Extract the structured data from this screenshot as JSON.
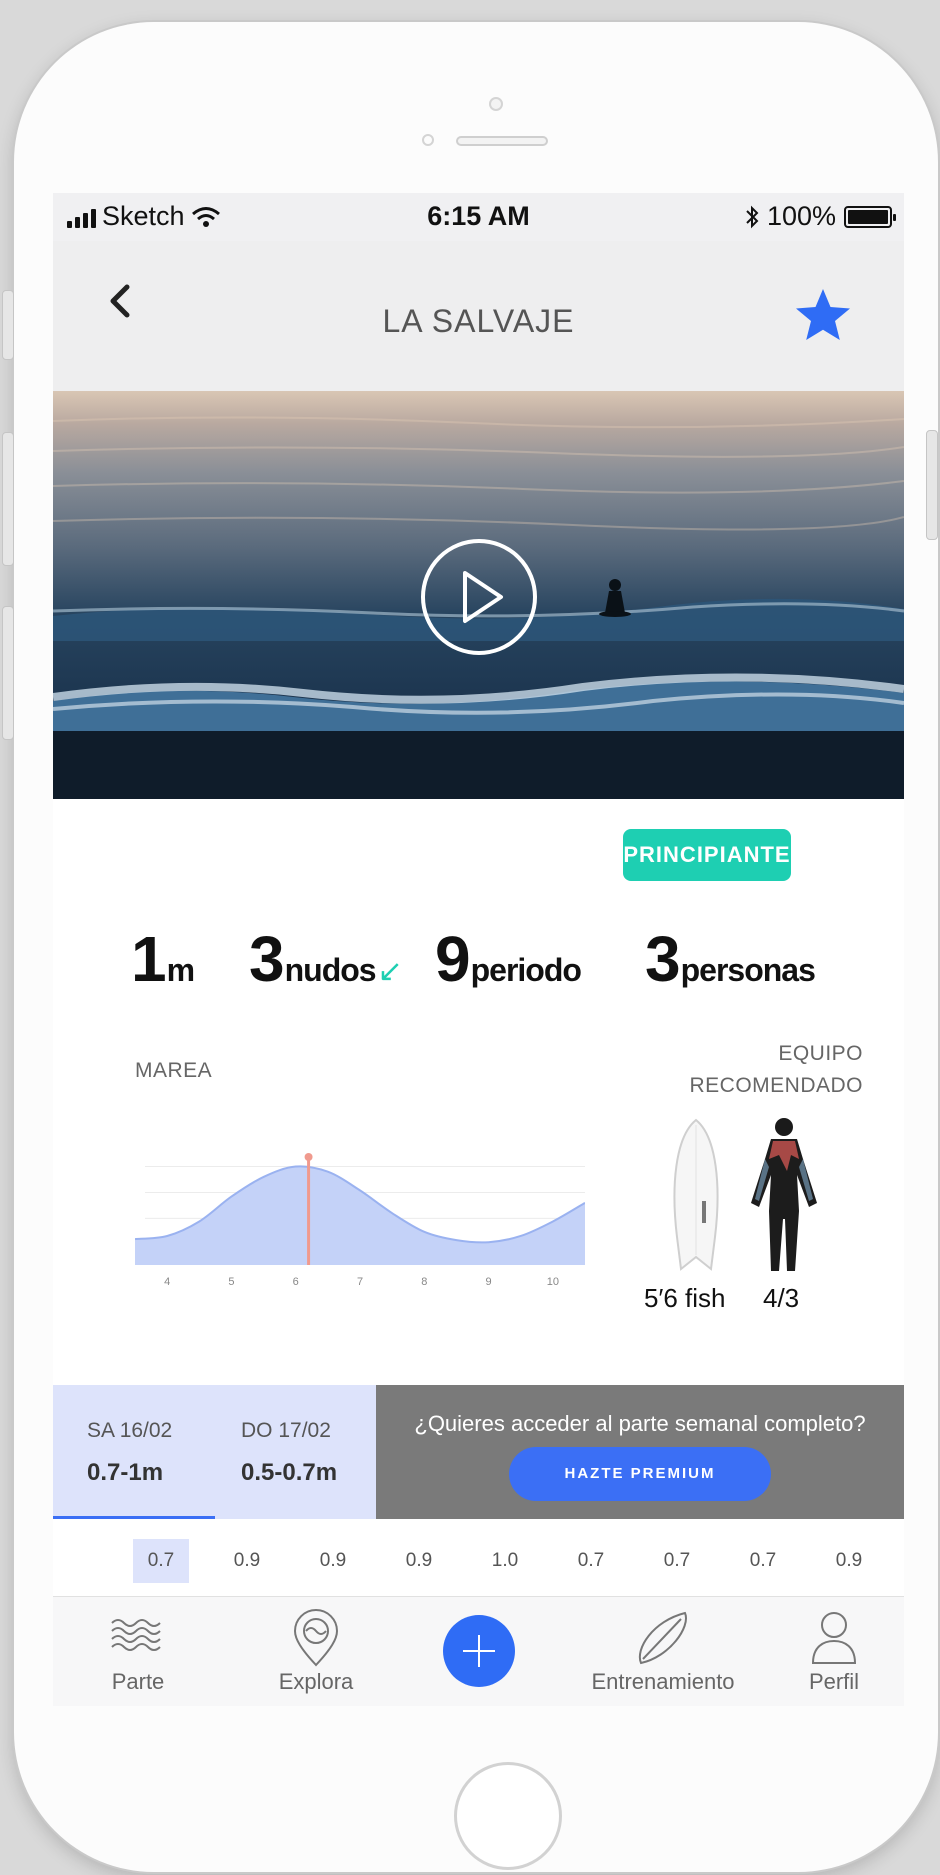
{
  "status_bar": {
    "carrier": "Sketch",
    "time": "6:15 AM",
    "battery": "100%"
  },
  "nav": {
    "title": "LA SALVAJE",
    "back_icon": "chevron-left-icon",
    "favorite_icon": "star-icon"
  },
  "hero": {
    "play_icon": "play-icon"
  },
  "level_badge": "PRINCIPIANTE",
  "metrics": {
    "height": {
      "value": "1",
      "unit": "m"
    },
    "wind": {
      "value": "3",
      "unit": "nudos"
    },
    "period": {
      "value": "9",
      "unit": "periodo"
    },
    "crowd": {
      "value": "3",
      "unit": "personas"
    }
  },
  "tide": {
    "label": "MAREA",
    "chart_data": {
      "type": "area",
      "title": "MAREA",
      "x": [
        3.5,
        4,
        4.5,
        5,
        5.5,
        6,
        6.5,
        7,
        7.5,
        8,
        8.5,
        9,
        9.5,
        10,
        10.5
      ],
      "x_ticks": [
        "4",
        "5",
        "6",
        "7",
        "8",
        "9",
        "10"
      ],
      "values": [
        0.25,
        0.28,
        0.42,
        0.66,
        0.85,
        0.95,
        0.9,
        0.72,
        0.5,
        0.32,
        0.24,
        0.22,
        0.28,
        0.42,
        0.6
      ],
      "xlim": [
        3.5,
        10.5
      ],
      "ylim": [
        0,
        1.1
      ],
      "current_x": 6.2,
      "grid": true,
      "fill_color": "#c4d2f8",
      "line_color": "#9ab2f0",
      "marker_color": "#f09a8e"
    }
  },
  "equipment": {
    "label_line1": "EQUIPO",
    "label_line2": "RECOMENDADO",
    "board_label": "5′6 fish",
    "wetsuit_label": "4/3"
  },
  "forecast": {
    "days": [
      {
        "name": "SA 16/02",
        "value": "0.7-1m"
      },
      {
        "name": "DO 17/02",
        "value": "0.5-0.7m"
      }
    ],
    "premium_text": "¿Quieres acceder al parte semanal completo?",
    "premium_button": "HAZTE PREMIUM"
  },
  "hourly": [
    "0.7",
    "0.9",
    "0.9",
    "0.9",
    "1.0",
    "0.7",
    "0.7",
    "0.7",
    "0.9"
  ],
  "tabs": [
    {
      "label": "Parte",
      "icon": "waves-icon"
    },
    {
      "label": "Explora",
      "icon": "map-pin-icon"
    },
    {
      "label": "",
      "icon": "plus-icon"
    },
    {
      "label": "Entrenamiento",
      "icon": "surfboard-icon"
    },
    {
      "label": "Perfil",
      "icon": "user-icon"
    }
  ],
  "colors": {
    "accent": "#3b6ff5",
    "badge": "#1ecfb2",
    "premium_bg": "#7a7a7a"
  }
}
